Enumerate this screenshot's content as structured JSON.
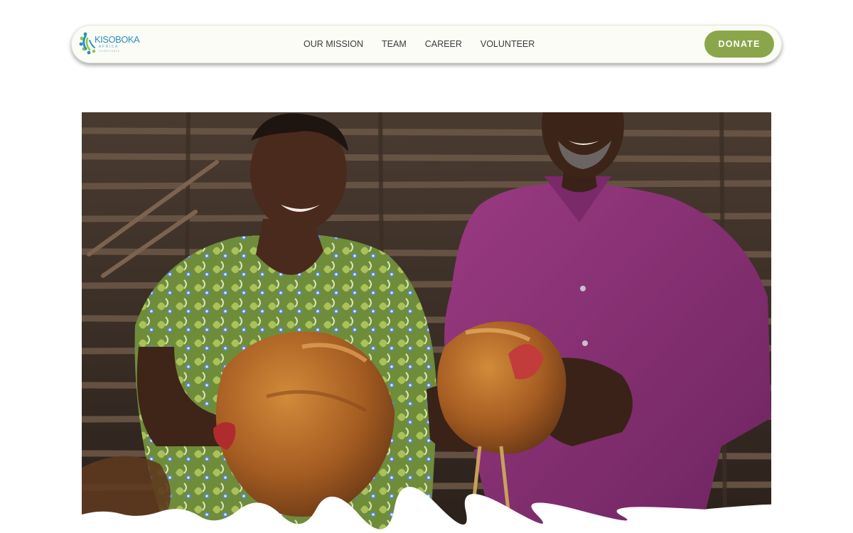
{
  "header": {
    "logo": {
      "name": "kisoboka-logo",
      "wordmark": "KISOBOKA",
      "tagline": "AFRICA",
      "subline": "CHARITABLE"
    },
    "nav": [
      {
        "label": "OUR MISSION"
      },
      {
        "label": "TEAM"
      },
      {
        "label": "CAREER"
      },
      {
        "label": "VOLUNTEER"
      }
    ],
    "donate_label": "DONATE"
  },
  "hero": {
    "image": "photo-two-farmers-holding-chickens",
    "description_icon": "hero-photo"
  },
  "colors": {
    "accent": "#8ba64a",
    "nav_text": "#3b3b3b",
    "logo_blue": "#2a8fbf",
    "logo_green": "#8cc63e",
    "navbar_bg": "#fbfcf6"
  }
}
